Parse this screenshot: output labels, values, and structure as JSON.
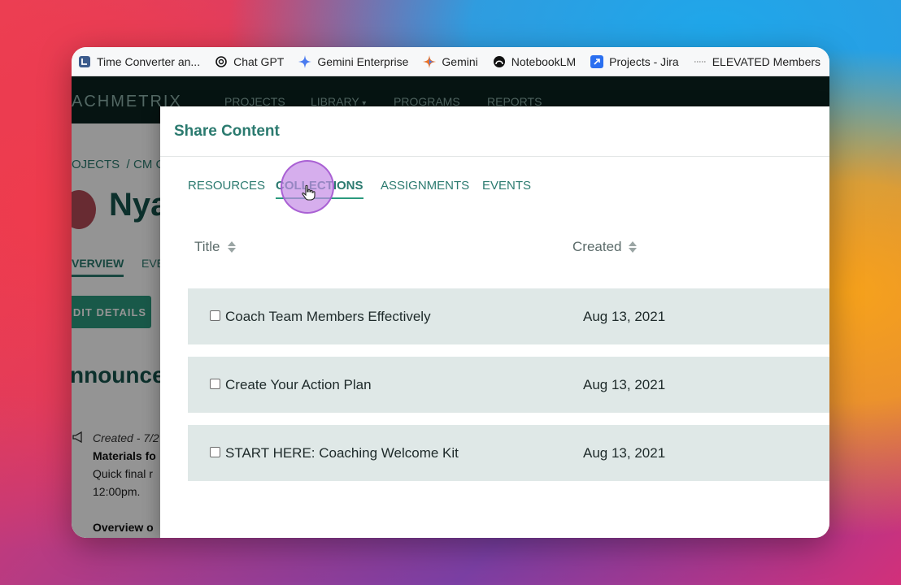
{
  "bookmarks": [
    {
      "label": "Time Converter an...",
      "icon": "clock-app-icon",
      "color": "#3b5b8c"
    },
    {
      "label": "Chat GPT",
      "icon": "chatgpt-icon",
      "color": "#111111"
    },
    {
      "label": "Gemini Enterprise",
      "icon": "gemini-sparkle-icon",
      "color": "#4a7bf0"
    },
    {
      "label": "Gemini",
      "icon": "gemini-sparkle-icon",
      "color": "#e8732a"
    },
    {
      "label": "NotebookLM",
      "icon": "notebooklm-icon",
      "color": "#111111"
    },
    {
      "label": "Projects - Jira",
      "icon": "jira-icon",
      "color": "#2a6ff0"
    },
    {
      "label": "ELEVATED Members",
      "icon": "dotted-line-icon",
      "color": "#888888"
    }
  ],
  "app": {
    "brand": "ACHMETRIX",
    "nav": [
      "PROJECTS",
      "LIBRARY",
      "PROGRAMS",
      "REPORTS"
    ],
    "breadcrumb": [
      "OJECTS",
      "/",
      "CM C"
    ],
    "name_partial": "Nya",
    "tabs": [
      "VERVIEW",
      "EVE"
    ],
    "edit_button": "DIT DETAILS",
    "section_title": "nnounce",
    "announcement": {
      "created": "Created - 7/2",
      "title": "Materials fo",
      "line1": "Quick final r",
      "line2": "12:00pm.",
      "overview": "Overview o"
    }
  },
  "modal": {
    "title": "Share Content",
    "tabs": [
      "RESOURCES",
      "COLLECTIONS",
      "ASSIGNMENTS",
      "EVENTS"
    ],
    "active_tab": "COLLECTIONS",
    "columns": {
      "title": "Title",
      "created": "Created"
    },
    "rows": [
      {
        "title": "Coach Team Members Effectively",
        "created": "Aug 13, 2021"
      },
      {
        "title": "Create Your Action Plan",
        "created": "Aug 13, 2021"
      },
      {
        "title": "START HERE: Coaching Welcome Kit",
        "created": "Aug 13, 2021"
      }
    ]
  },
  "colors": {
    "accent": "#2b7a6f",
    "row_bg": "#dfe8e7",
    "nav_bg": "#0c2420"
  }
}
